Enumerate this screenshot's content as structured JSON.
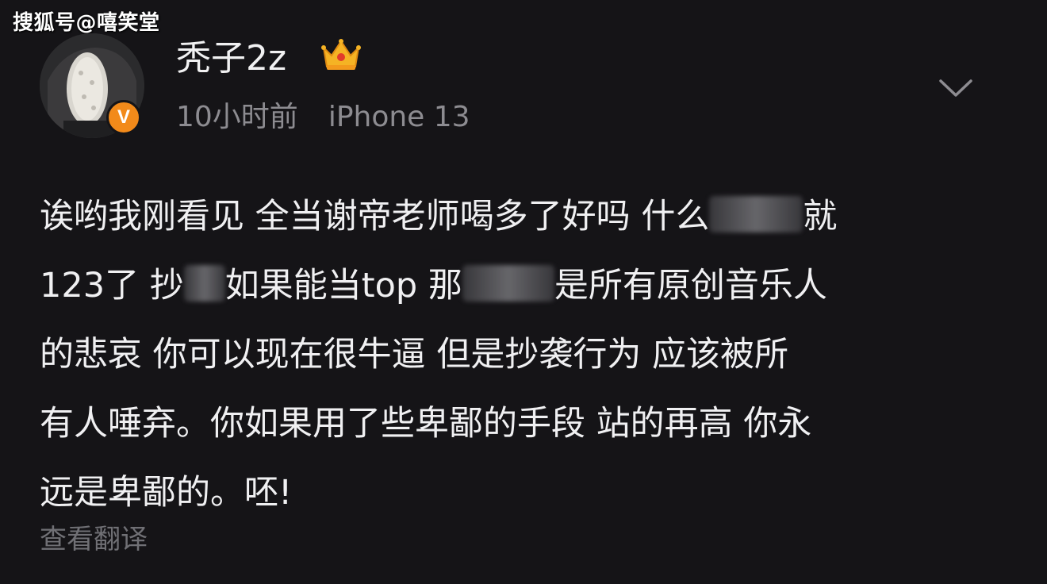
{
  "watermark": "搜狐号@嘻笑堂",
  "post": {
    "username": "秃子2z",
    "time": "10小时前",
    "device": "iPhone 13",
    "verified_mark": "V",
    "lines": [
      [
        "诶哟我刚看见 全当谢帝老师喝多了好吗 什么",
        "就"
      ],
      [
        "123了 抄",
        "如果能当top 那",
        "是所有原创音乐人"
      ],
      [
        "的悲哀 你可以现在很牛逼 但是抄袭行为 应该被所"
      ],
      [
        "有人唾弃。你如果用了些卑鄙的手段 站的再高 你永"
      ],
      [
        "远是卑鄙的。呸!"
      ]
    ],
    "translate_label": "查看翻译"
  },
  "colors": {
    "background": "#151417",
    "text": "#f0f0f2",
    "meta": "#8d8c91",
    "badge": "#f28a1a",
    "crown": "#f5b324"
  }
}
